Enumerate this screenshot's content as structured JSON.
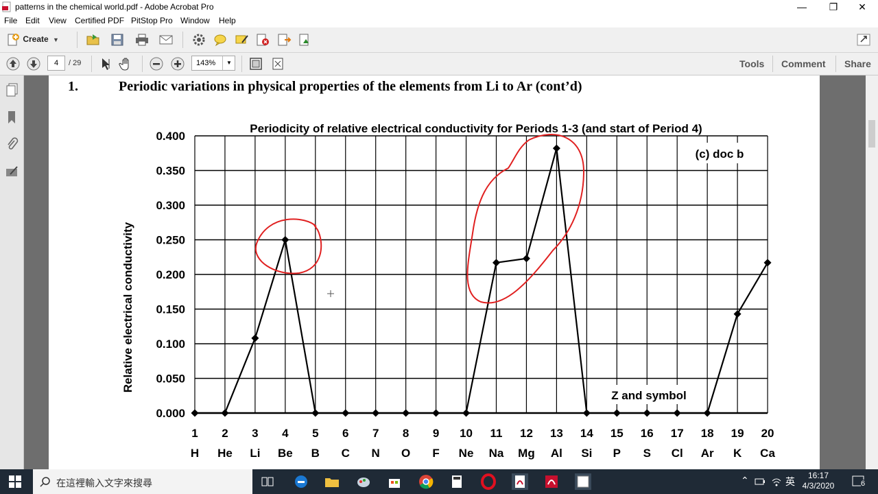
{
  "window": {
    "title": "patterns in the chemical world.pdf - Adobe Acrobat Pro",
    "minimize": "—",
    "restore": "❐",
    "close": "✕"
  },
  "menu": [
    "File",
    "Edit",
    "View",
    "Certified PDF",
    "PitStop Pro",
    "Window",
    "Help"
  ],
  "toolbar": {
    "create_label": "Create",
    "page_current": "4",
    "page_total": "/ 29",
    "zoom": "143%",
    "tools_label": "Tools",
    "comment_label": "Comment",
    "share_label": "Share"
  },
  "document": {
    "heading_number": "1.",
    "heading_text": "Periodic variations in physical properties of the elements from Li to Ar (cont’d)"
  },
  "chart_data": {
    "type": "line",
    "title": "Periodicity of relative electrical conductivity for Periods 1-3 (and start of Period 4)",
    "annotation": "(c) doc b",
    "xlabel": "Z and symbol",
    "ylabel": "Relative electrical conductivity",
    "x_numbers": [
      "1",
      "2",
      "3",
      "4",
      "5",
      "6",
      "7",
      "8",
      "9",
      "10",
      "11",
      "12",
      "13",
      "14",
      "15",
      "16",
      "17",
      "18",
      "19",
      "20"
    ],
    "x_symbols": [
      "H",
      "He",
      "Li",
      "Be",
      "B",
      "C",
      "N",
      "O",
      "F",
      "Ne",
      "Na",
      "Mg",
      "Al",
      "Si",
      "P",
      "S",
      "Cl",
      "Ar",
      "K",
      "Ca"
    ],
    "values": [
      0,
      0,
      0.108,
      0.25,
      0,
      0,
      0,
      0,
      0,
      0,
      0.217,
      0.223,
      0.382,
      0,
      0,
      0,
      0,
      0,
      0.143,
      0.217
    ],
    "ylim": [
      0,
      0.4
    ],
    "yticks": [
      "0.000",
      "0.050",
      "0.100",
      "0.150",
      "0.200",
      "0.250",
      "0.300",
      "0.350",
      "0.400"
    ],
    "grid": true,
    "line_color": "#000000",
    "highlight_color": "#e02020"
  },
  "taskbar": {
    "search_placeholder": "在這裡輸入文字來搜尋",
    "ime": "英",
    "time": "16:17",
    "date": "4/3/2020",
    "notifications": "6"
  }
}
